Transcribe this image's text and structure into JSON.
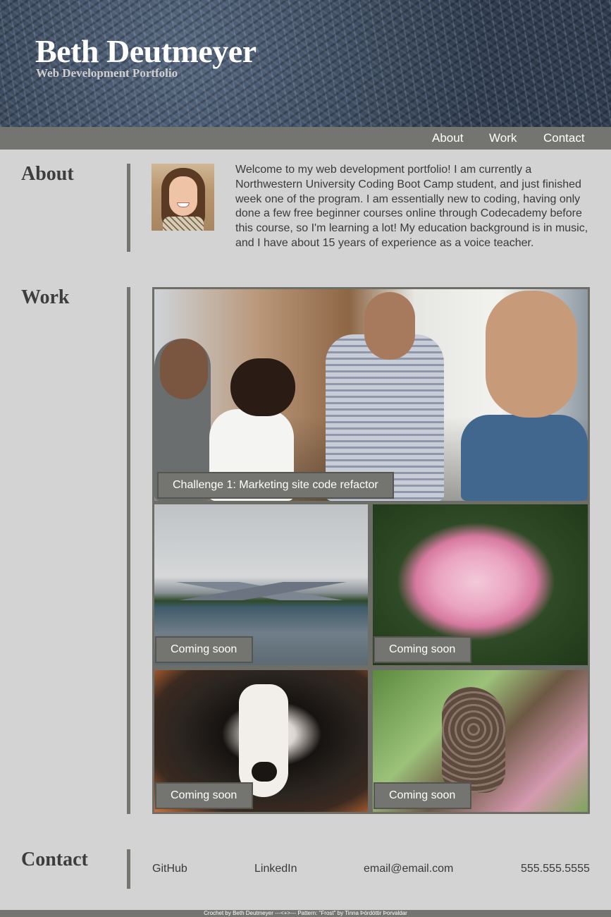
{
  "header": {
    "title": "Beth Deutmeyer",
    "subtitle": "Web Development Portfolio"
  },
  "nav": {
    "about": "About",
    "work": "Work",
    "contact": "Contact"
  },
  "about": {
    "heading": "About",
    "text": "Welcome to my web development portfolio! I am currently a Northwestern University Coding Boot Camp student, and just finished week one of the program. I am essentially new to coding, having only done a few free beginner courses online through Codecademy before this course, so I'm learning a lot! My education background is in music, and I have about 15 years of experience as a voice teacher."
  },
  "work": {
    "heading": "Work",
    "projects": [
      {
        "caption": "Challenge 1: Marketing site code refactor"
      },
      {
        "caption": "Coming soon"
      },
      {
        "caption": "Coming soon"
      },
      {
        "caption": "Coming soon"
      },
      {
        "caption": "Coming soon"
      }
    ]
  },
  "contact": {
    "heading": "Contact",
    "github": "GitHub",
    "linkedin": "LinkedIn",
    "email": "email@email.com",
    "phone": "555.555.5555"
  },
  "footer": {
    "credit": "Crochet by Beth Deutmeyer ---<+>--- Pattern: \"Frost\" by Tinna Þórdóttir Þorvaldar"
  },
  "colors": {
    "background": "#d3d3d3",
    "bar": "#747570",
    "text": "#3a3a3a"
  }
}
